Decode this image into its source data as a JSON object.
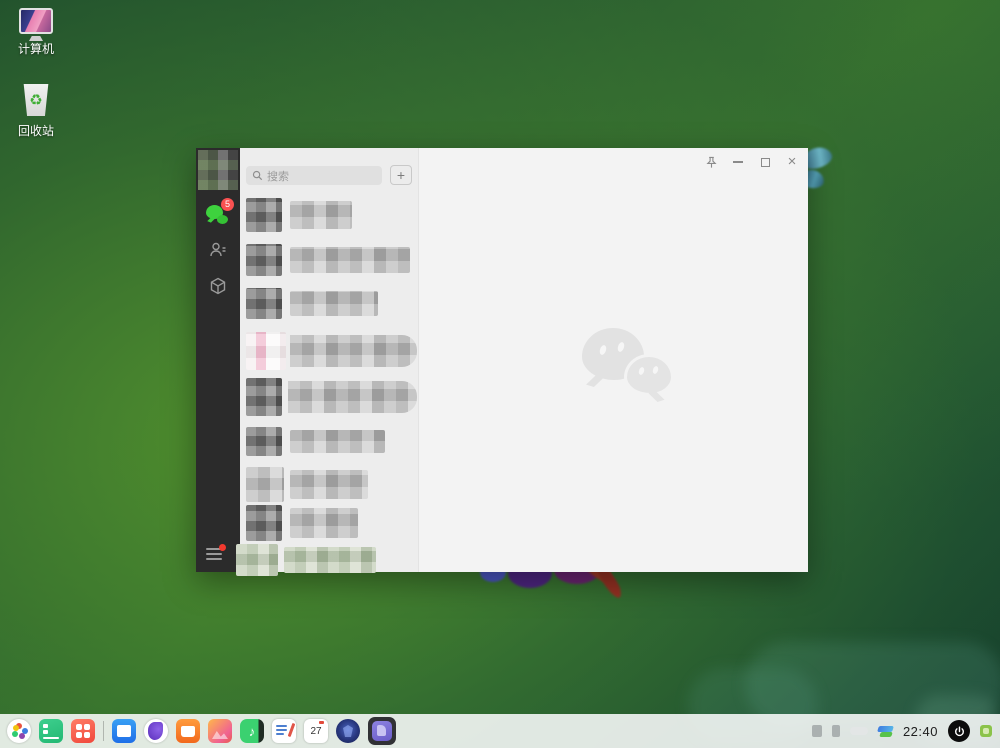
{
  "desktop": {
    "icons": {
      "computer": "计算机",
      "recycle": "回收站",
      "recycle_glyph": "♻"
    }
  },
  "wechat": {
    "search_placeholder": "搜索",
    "add_label": "+",
    "unread_badge": "5",
    "close_glyph": "×",
    "nav_icons": [
      "chats-icon",
      "contacts-icon",
      "collections-icon",
      "menu-icon"
    ],
    "titlebar_icons": [
      "pin-icon",
      "minimize-icon",
      "maximize-icon",
      "close-icon"
    ]
  },
  "taskbar": {
    "calendar_day": "27",
    "clock": "22:40",
    "music_glyph": "♪",
    "app_icons": [
      "launcher-icon",
      "multitasking-icon",
      "app-grid-icon",
      "file-manager-icon",
      "browser-icon",
      "app-store-icon",
      "image-viewer-icon",
      "music-icon",
      "text-editor-icon",
      "calendar-icon",
      "security-center-icon",
      "wechat-active-icon"
    ],
    "tray_icons": [
      "tray-icon",
      "tray-icon",
      "battery-icon",
      "input-method-icon",
      "power-icon",
      "desktop-plugin-icon"
    ]
  },
  "colors": {
    "wechat_green": "#3ed23e",
    "badge_red": "#fa5151",
    "sidebar_dark": "#2b2b2b",
    "wallpaper_green": "#35712f"
  }
}
